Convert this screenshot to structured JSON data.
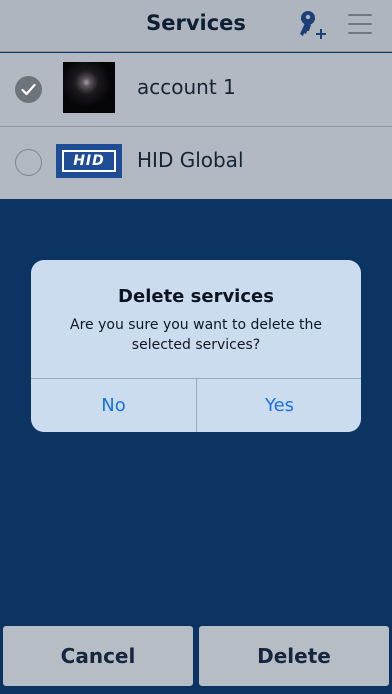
{
  "header": {
    "title": "Services",
    "icons": [
      "add-key-icon",
      "menu-icon"
    ]
  },
  "services": [
    {
      "label": "account 1",
      "selected": true,
      "thumbnail": "galaxy-image"
    },
    {
      "label": "HID Global",
      "selected": false,
      "thumbnail": "hid-logo",
      "logo_text": "HID"
    }
  ],
  "dialog": {
    "title": "Delete services",
    "message": "Are you sure you want to delete the selected services?",
    "no_label": "No",
    "yes_label": "Yes"
  },
  "footer": {
    "cancel_label": "Cancel",
    "delete_label": "Delete"
  },
  "colors": {
    "background": "#0b3463",
    "accent": "#1a73de",
    "dialog": "#ccdcef"
  }
}
